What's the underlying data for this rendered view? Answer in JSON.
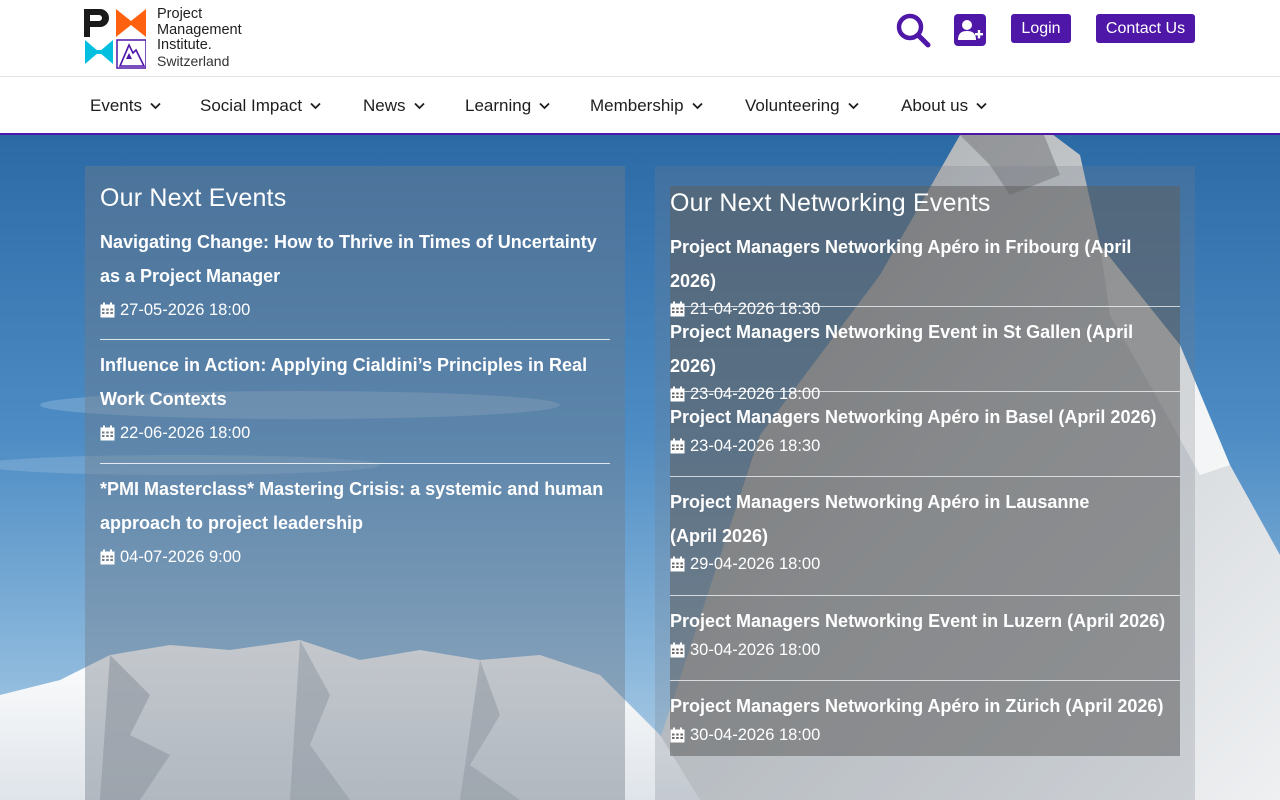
{
  "brand": {
    "line1": "Project",
    "line2": "Management",
    "line3": "Institute.",
    "line4": "Switzerland",
    "colors": {
      "black": "#1a1a1a",
      "orange": "#ff610f",
      "cyan": "#05bfe0",
      "purple": "#4f17a8"
    }
  },
  "header": {
    "search_icon": "search-icon",
    "join_icon": "user-plus-icon",
    "login_label": "Login",
    "contact_label": "Contact Us"
  },
  "nav": {
    "items": [
      {
        "label": "Events"
      },
      {
        "label": "Social Impact"
      },
      {
        "label": "News"
      },
      {
        "label": "Learning"
      },
      {
        "label": "Membership"
      },
      {
        "label": "Volunteering"
      },
      {
        "label": "About us"
      }
    ]
  },
  "events": {
    "title": "Our Next Events",
    "items": [
      {
        "title": "Navigating Change: How to Thrive in Times of Uncertainty as a Project Manager",
        "date": "27-05-2026 18:00"
      },
      {
        "title": "Influence in Action: Applying Cialdini’s Principles in Real Work Contexts",
        "date": "22-06-2026 18:00"
      },
      {
        "title": "*PMI Masterclass* Mastering Crisis: a systemic and human approach to project leadership",
        "date": "04-07-2026 9:00"
      }
    ]
  },
  "networking": {
    "title": "Our Next Networking Events",
    "items": [
      {
        "title": "Project Managers Networking Apéro in Fribourg (April 2026)",
        "date": "21-04-2026 18:30"
      },
      {
        "title": "Project Managers Networking Event in St Gallen (April 2026)",
        "date": "23-04-2026 18:00"
      },
      {
        "title": "Project Managers Networking Apéro in Basel (April 2026)",
        "date": "23-04-2026 18:30"
      },
      {
        "title": "Project Managers Networking Apéro in Lausanne (April 2026)",
        "date": "29-04-2026 18:00"
      },
      {
        "title": "Project Managers Networking Event in Luzern (April 2026)",
        "date": "30-04-2026 18:00"
      },
      {
        "title": "Project Managers Networking Apéro in Zürich (April 2026)",
        "date": "30-04-2026 18:00"
      }
    ]
  },
  "theme": {
    "accent": "#4f17a8"
  }
}
